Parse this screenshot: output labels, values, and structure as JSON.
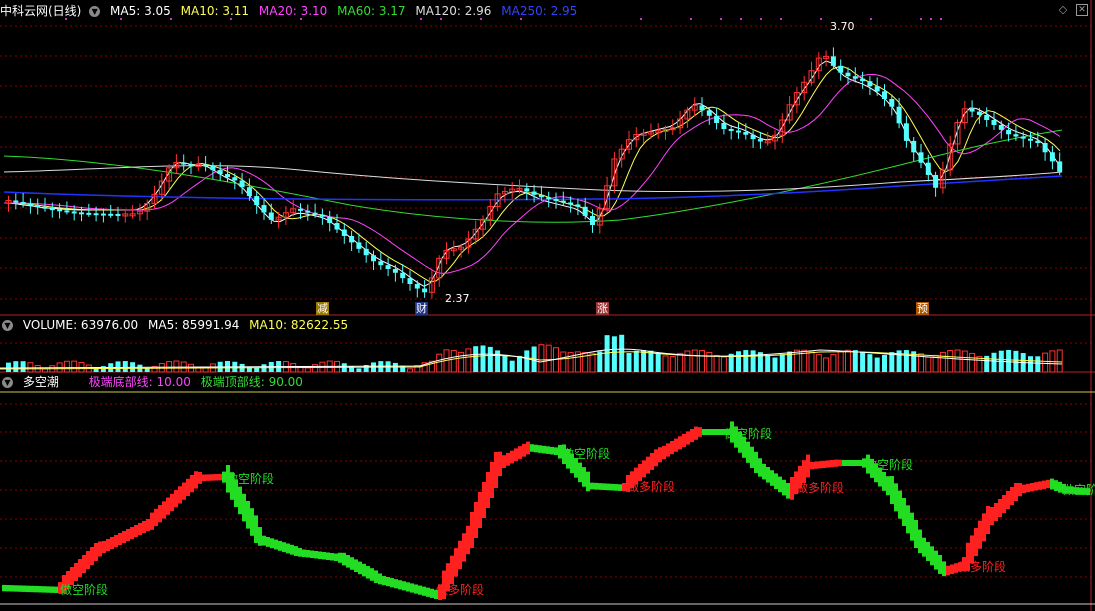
{
  "main": {
    "title": "中科云网(日线)",
    "indicators": [
      {
        "label": "MA5: 3.05",
        "color": "#ffffff"
      },
      {
        "label": "MA10: 3.11",
        "color": "#ffff55"
      },
      {
        "label": "MA20: 3.10",
        "color": "#ff44ff"
      },
      {
        "label": "MA60: 3.17",
        "color": "#33dd33"
      },
      {
        "label": "MA120: 2.96",
        "color": "#dddddd"
      },
      {
        "label": "MA250: 2.95",
        "color": "#2233ff"
      }
    ],
    "high_label": "3.70",
    "low_label": "2.37",
    "markers": [
      {
        "text": "减",
        "bg": "#997700",
        "fg": "#ffffff"
      },
      {
        "text": "财",
        "bg": "#223388",
        "fg": "#ffffff"
      },
      {
        "text": "涨",
        "bg": "#993333",
        "fg": "#ffffff"
      },
      {
        "text": "预",
        "bg": "#aa5500",
        "fg": "#ffffff"
      }
    ]
  },
  "volume": {
    "title": "VOLUME: 63976.00",
    "ma5": "MA5: 85991.94",
    "ma10": "MA10: 82622.55"
  },
  "indicator_panel": {
    "title": "多空潮",
    "bottom_line": "极端底部线: 10.00",
    "top_line": "极端顶部线: 90.00",
    "label_short": "做空阶段",
    "label_long": "做多阶段"
  },
  "colors": {
    "up": "#ff3232",
    "down": "#54ffff",
    "grid": "#8b0000",
    "frame": "#b22222",
    "wave_up": "#ff2020",
    "wave_down": "#22dd22"
  }
}
